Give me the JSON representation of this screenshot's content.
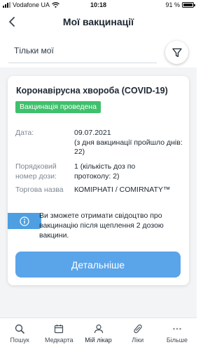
{
  "status_bar": {
    "carrier": "Vodafone UA",
    "time": "10:18",
    "battery": "91 %"
  },
  "nav": {
    "title": "Мої вакцинації"
  },
  "filter": {
    "value": "Тільки мої"
  },
  "card": {
    "title": "Коронавірусна хвороба (COVID-19)",
    "status": "Вакцинація проведена",
    "status_color": "#3ec16b",
    "details": [
      {
        "label": "Дата:",
        "value": "09.07.2021\n(з дня вакцинації пройшло днів: 22)"
      },
      {
        "label": "Порядковий номер дози:",
        "value": "1 (кількість доз по протоколу: 2)"
      },
      {
        "label": "Торгова назва",
        "value": "КОМІРНАТІ / COMIRNATY™"
      }
    ],
    "info": "Ви зможете отримати свідоцтво про вакцинацію після щеплення 2 дозою вакцини.",
    "button": "Детальніше",
    "button_color": "#5aa4ea"
  },
  "tabs": [
    {
      "label": "Пошук",
      "icon": "search-icon"
    },
    {
      "label": "Медкарта",
      "icon": "calendar-icon"
    },
    {
      "label": "Мій лікар",
      "icon": "user-icon"
    },
    {
      "label": "Ліки",
      "icon": "pill-icon"
    },
    {
      "label": "Більше",
      "icon": "more-icon"
    }
  ]
}
